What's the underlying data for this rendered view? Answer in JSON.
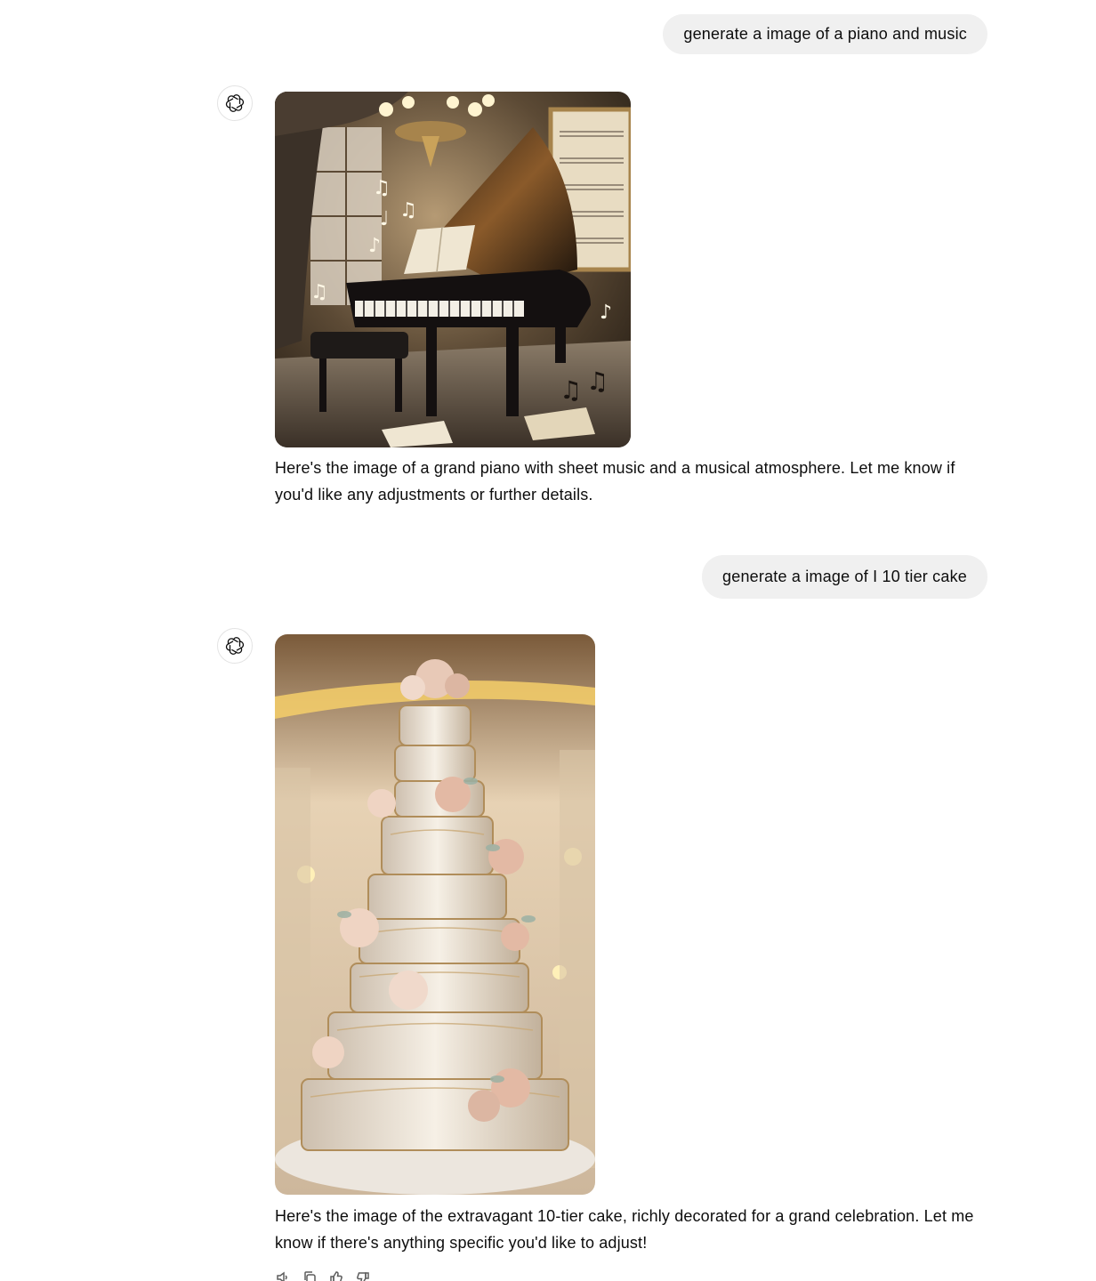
{
  "conversation": {
    "messages": [
      {
        "role": "user",
        "text": "generate a image of a piano and music"
      },
      {
        "role": "assistant",
        "text": "Here's the image of a grand piano with sheet music and a musical atmosphere. Let me know if you'd like any adjustments or further details."
      },
      {
        "role": "user",
        "text": "generate a image of I 10 tier cake"
      },
      {
        "role": "assistant",
        "text": "Here's the image of the extravagant 10-tier cake, richly decorated for a grand celebration. Let me know if there's anything specific you'd like to adjust!"
      }
    ]
  },
  "icons": {
    "avatar": "openai-logo-icon",
    "actions": [
      "speaker-icon",
      "copy-icon",
      "thumbs-up-icon",
      "thumbs-down-icon"
    ]
  },
  "colors": {
    "user_bubble": "#f0f0f0",
    "text": "#0d0d0d"
  }
}
